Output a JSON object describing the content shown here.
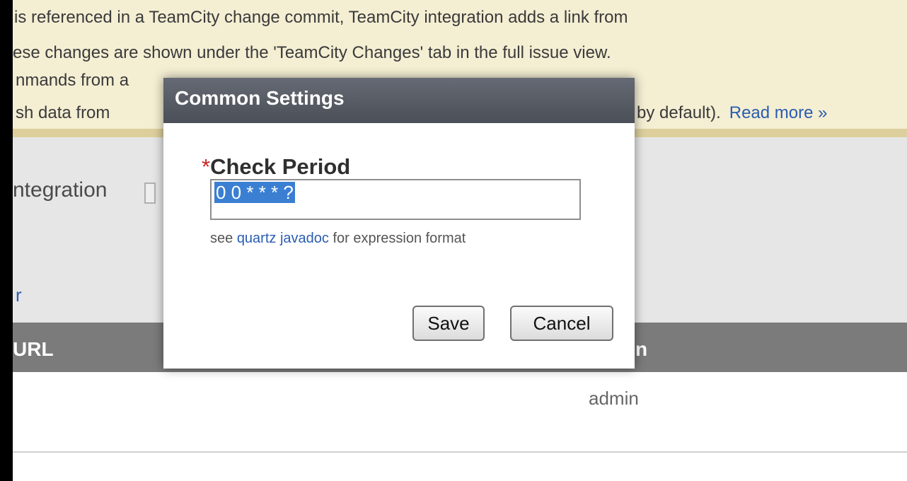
{
  "banner": {
    "line1": "is referenced in a TeamCity change commit, TeamCity integration adds a link from",
    "line2": "ese changes are shown under the 'TeamCity Changes' tab in the full issue view.",
    "line3": "nmands from a",
    "line4": "sh data from",
    "tail_text": "by default).",
    "read_more": "Read more »"
  },
  "settings": {
    "integration_label": "ntegration",
    "link_fragment": "r"
  },
  "table": {
    "headers": [
      "URL",
      "n"
    ],
    "rows": [
      {
        "user": "admin"
      }
    ]
  },
  "dialog": {
    "title": "Common Settings",
    "field_label": "Check Period",
    "required_marker": "*",
    "field_value": "0 0 * * * ?",
    "hint_prefix": "see",
    "hint_link": "quartz javadoc",
    "hint_suffix": "for expression format",
    "save_label": "Save",
    "cancel_label": "Cancel"
  }
}
